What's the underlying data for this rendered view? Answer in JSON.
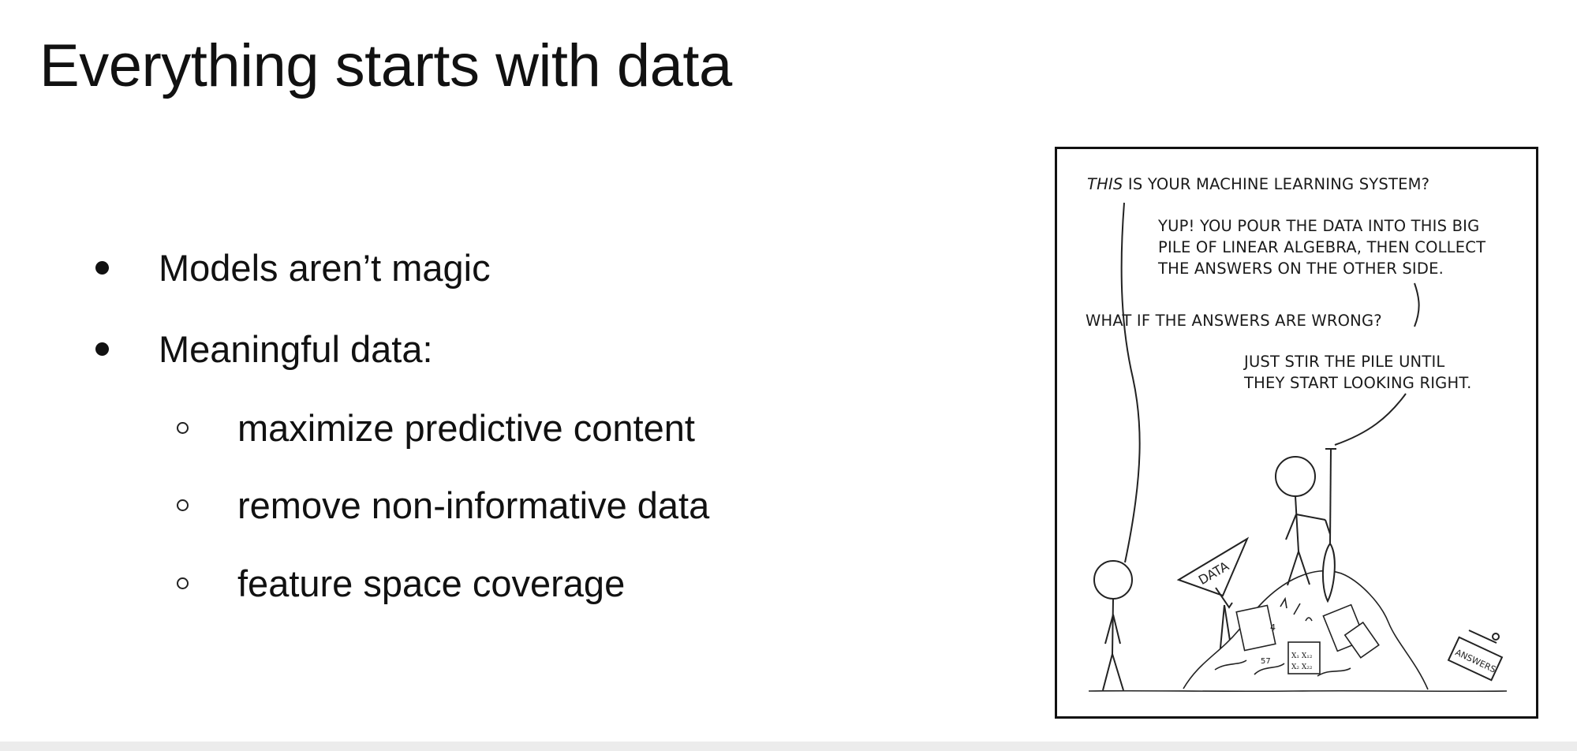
{
  "slide": {
    "title": "Everything starts with data",
    "bullets": [
      {
        "text": "Models aren’t magic"
      },
      {
        "text": "Meaningful data:"
      }
    ],
    "sub_bullets": [
      {
        "text": "maximize predictive content"
      },
      {
        "text": "remove non-informative data"
      },
      {
        "text": "feature space coverage"
      }
    ]
  },
  "comic": {
    "line1_emph": "THIS",
    "line1_rest": " IS YOUR MACHINE LEARNING SYSTEM?",
    "reply_lines": [
      "YUP!  YOU POUR THE DATA INTO THIS BIG",
      "PILE OF LINEAR ALGEBRA, THEN COLLECT",
      "THE ANSWERS ON THE OTHER SIDE."
    ],
    "question": "WHAT IF THE ANSWERS ARE WRONG?",
    "answer_lines": [
      "JUST STIR THE PILE UNTIL",
      "THEY START LOOKING RIGHT."
    ],
    "funnel_label": "DATA",
    "box_label": "ANSWERS"
  }
}
